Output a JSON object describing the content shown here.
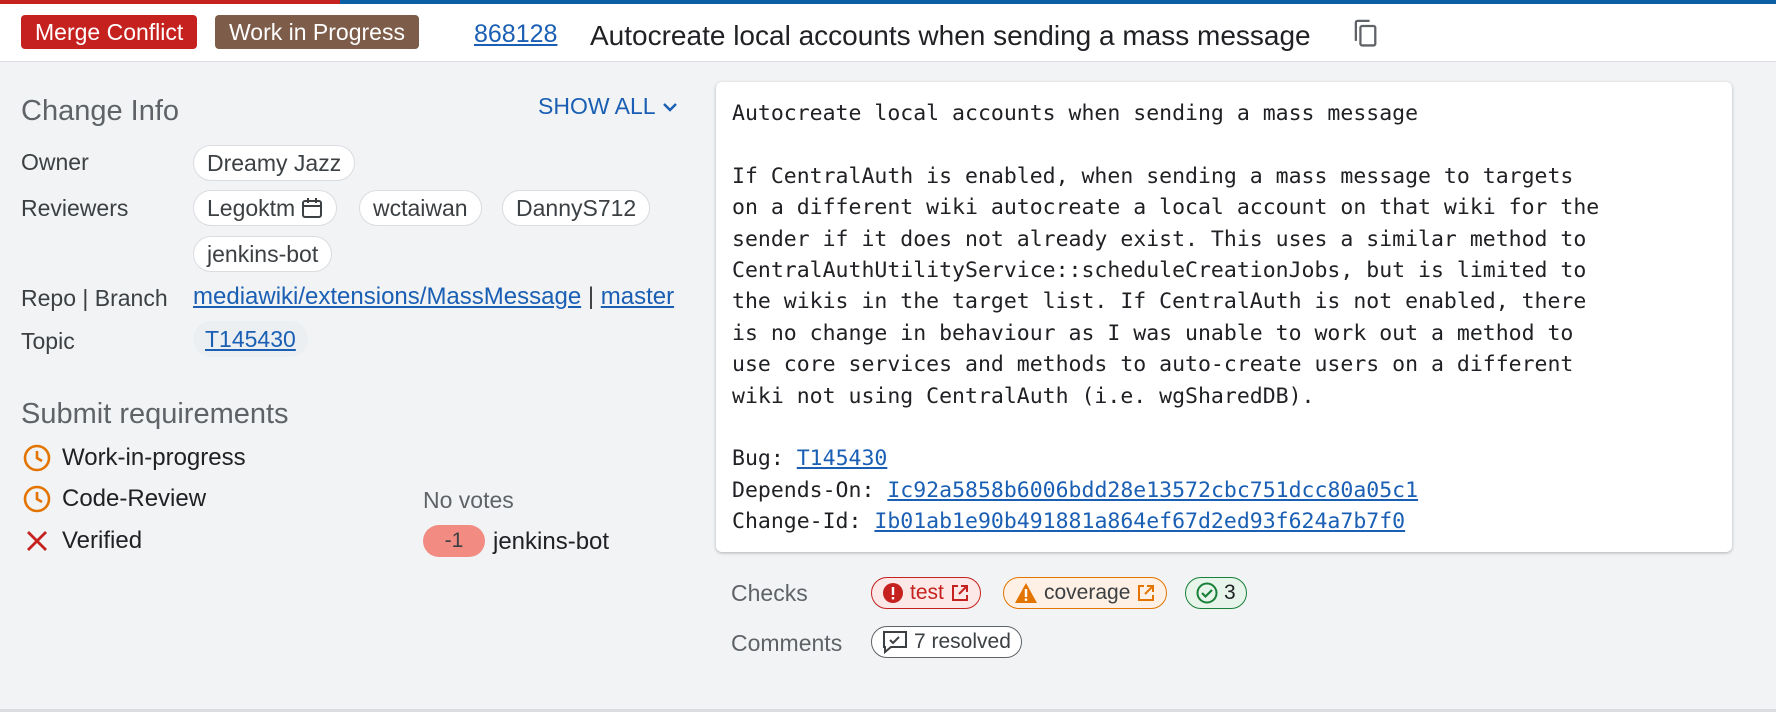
{
  "header": {
    "status_merge_conflict": "Merge Conflict",
    "status_wip": "Work in Progress",
    "change_number": "868128",
    "title": "Autocreate local accounts when sending a mass message",
    "copy_icon": "copy-icon"
  },
  "change_info": {
    "heading": "Change Info",
    "show_all": "SHOW ALL",
    "owner_label": "Owner",
    "owner": "Dreamy Jazz",
    "reviewers_label": "Reviewers",
    "reviewers": [
      "Legoktm",
      "wctaiwan",
      "DannyS712",
      "jenkins-bot"
    ],
    "repo_label": "Repo | Branch",
    "repo": "mediawiki/extensions/MassMessage",
    "separator": "|",
    "branch": "master",
    "topic_label": "Topic",
    "topic": "T145430"
  },
  "submit_requirements": {
    "heading": "Submit requirements",
    "items": [
      {
        "name": "Work-in-progress",
        "icon": "clock-icon"
      },
      {
        "name": "Code-Review",
        "icon": "clock-icon",
        "vote_text": "No votes"
      },
      {
        "name": "Verified",
        "icon": "x-icon",
        "vote": "-1",
        "voter": "jenkins-bot"
      }
    ]
  },
  "commit_message": {
    "subject": "Autocreate local accounts when sending a mass message",
    "body": "If CentralAuth is enabled, when sending a mass message to targets\non a different wiki autocreate a local account on that wiki for the\nsender if it does not already exist. This uses a similar method to\nCentralAuthUtilityService::scheduleCreationJobs, but is limited to\nthe wikis in the target list. If CentralAuth is not enabled, there\nis no change in behaviour as I was unable to work out a method to\nuse core services and methods to auto-create users on a different\nwiki not using CentralAuth (i.e. wgSharedDB).",
    "bug_label": "Bug: ",
    "bug": "T145430",
    "depends_label": "Depends-On: ",
    "depends_on": "Ic92a5858b6006bdd28e13572cbc751dcc80a05c1",
    "change_id_label": "Change-Id: ",
    "change_id": "Ib01ab1e90b491881a864ef67d2ed93f624a7b7f0"
  },
  "checks": {
    "label": "Checks",
    "error_check": "test",
    "warning_check": "coverage",
    "success_count": "3"
  },
  "comments": {
    "label": "Comments",
    "resolved": "7 resolved"
  },
  "colors": {
    "merge_conflict": "#c5221f",
    "work_in_progress": "#7d5c4a",
    "link": "#1a5fb4",
    "pending": "#e37400",
    "error": "#c5221f",
    "success": "#188038"
  }
}
